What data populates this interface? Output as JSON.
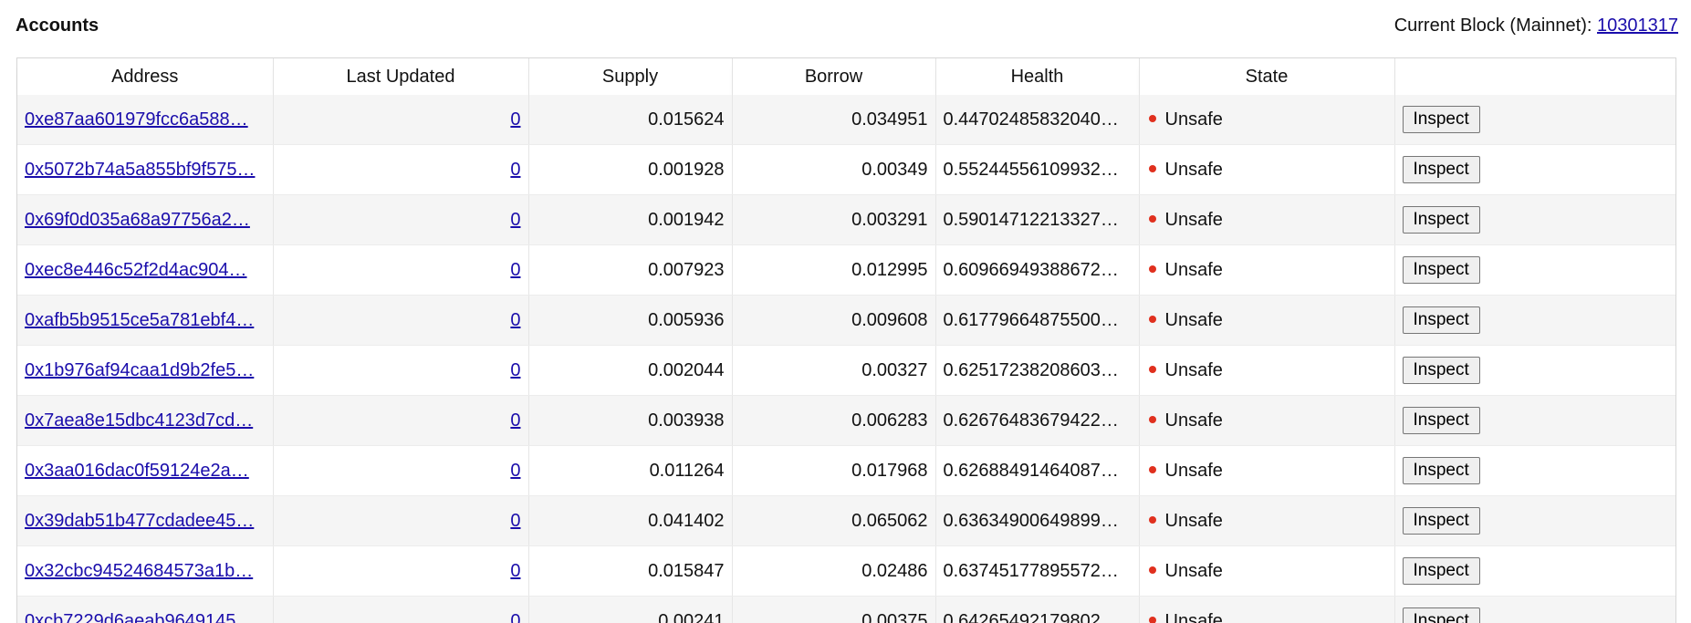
{
  "header": {
    "title": "Accounts",
    "block_label": "Current Block (Mainnet):",
    "block_number": "10301317"
  },
  "table": {
    "columns": [
      "Address",
      "Last Updated",
      "Supply",
      "Borrow",
      "Health",
      "State",
      ""
    ],
    "inspect_label": "Inspect",
    "rows": [
      {
        "address": "0xe87aa601979fcc6a588…",
        "last_updated": "0",
        "supply": "0.015624",
        "borrow": "0.034951",
        "health": "0.44702485832040…",
        "state": "Unsafe"
      },
      {
        "address": "0x5072b74a5a855bf9f575…",
        "last_updated": "0",
        "supply": "0.001928",
        "borrow": "0.00349",
        "health": "0.55244556109932…",
        "state": "Unsafe"
      },
      {
        "address": "0x69f0d035a68a97756a2…",
        "last_updated": "0",
        "supply": "0.001942",
        "borrow": "0.003291",
        "health": "0.59014712213327…",
        "state": "Unsafe"
      },
      {
        "address": "0xec8e446c52f2d4ac904…",
        "last_updated": "0",
        "supply": "0.007923",
        "borrow": "0.012995",
        "health": "0.60966949388672…",
        "state": "Unsafe"
      },
      {
        "address": "0xafb5b9515ce5a781ebf4…",
        "last_updated": "0",
        "supply": "0.005936",
        "borrow": "0.009608",
        "health": "0.61779664875500…",
        "state": "Unsafe"
      },
      {
        "address": "0x1b976af94caa1d9b2fe5…",
        "last_updated": "0",
        "supply": "0.002044",
        "borrow": "0.00327",
        "health": "0.62517238208603…",
        "state": "Unsafe"
      },
      {
        "address": "0x7aea8e15dbc4123d7cd…",
        "last_updated": "0",
        "supply": "0.003938",
        "borrow": "0.006283",
        "health": "0.62676483679422…",
        "state": "Unsafe"
      },
      {
        "address": "0x3aa016dac0f59124e2a…",
        "last_updated": "0",
        "supply": "0.011264",
        "borrow": "0.017968",
        "health": "0.62688491464087…",
        "state": "Unsafe"
      },
      {
        "address": "0x39dab51b477cdadee45…",
        "last_updated": "0",
        "supply": "0.041402",
        "borrow": "0.065062",
        "health": "0.63634900649899…",
        "state": "Unsafe"
      },
      {
        "address": "0x32cbc94524684573a1b…",
        "last_updated": "0",
        "supply": "0.015847",
        "borrow": "0.02486",
        "health": "0.63745177895572…",
        "state": "Unsafe"
      },
      {
        "address": "0xcb7229d6aeab9649145…",
        "last_updated": "0",
        "supply": "0.00241",
        "borrow": "0.00375",
        "health": "0.64265492179802…",
        "state": "Unsafe"
      }
    ]
  },
  "colors": {
    "link": "#1a0dab",
    "unsafe_dot": "#e0301e",
    "row_alt": "#f5f5f5"
  }
}
